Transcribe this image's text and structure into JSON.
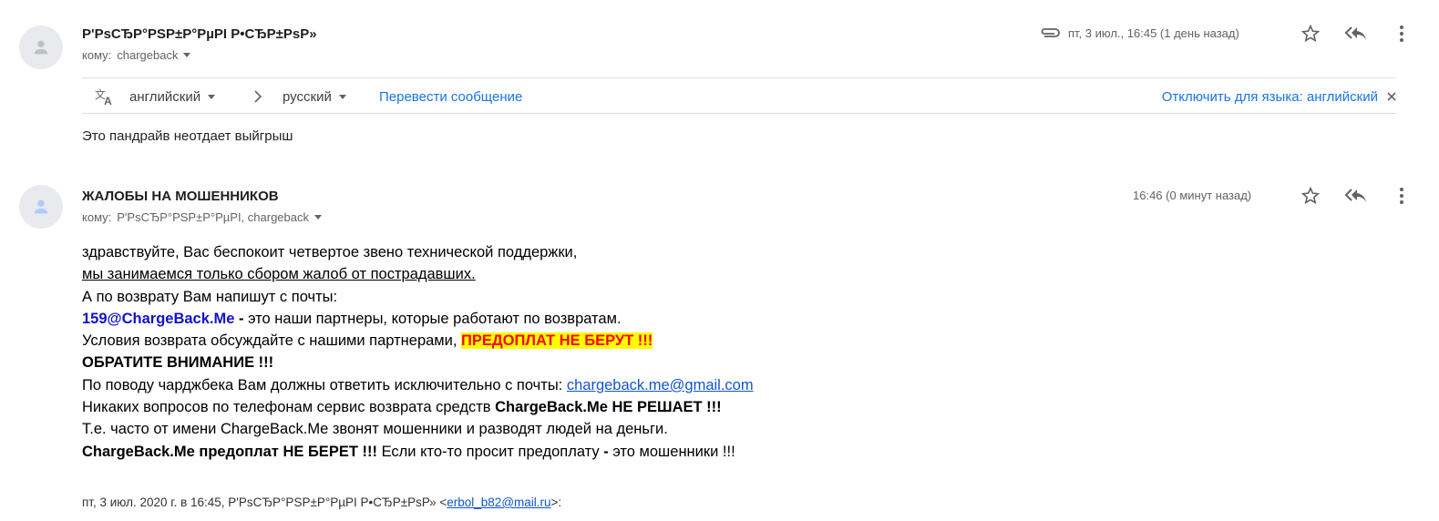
{
  "messages": [
    {
      "sender": "Р'РѕСЂР°РЅР±Р°РµРІ Р•СЂР±РѕР»",
      "to_prefix": "кому:",
      "to": "chargeback",
      "timestamp": "пт, 3 июл., 16:45 (1 день назад)",
      "has_attachment": true
    },
    {
      "sender": "ЖАЛОБЫ НА МОШЕННИКОВ",
      "to_prefix": "кому:",
      "to": "Р'РѕСЂР°РЅР±Р°РµРІ, chargeback",
      "timestamp": "16:46 (0 минут назад)"
    }
  ],
  "translate": {
    "from_lang": "английский",
    "to_lang": "русский",
    "translate_link": "Перевести сообщение",
    "disable_link": "Отключить для языка: английский"
  },
  "message1_body": "Это пандрайв неотдает выйгрыш",
  "message2_body": {
    "l1": "здравствуйте, Вас беспокоит четвертое звено технической поддержки,",
    "l2": "мы занимаемся только сбором жалоб от пострадавших.",
    "l3": "А по возврату Вам напишут с почты:",
    "l4_email": "159@ChargeBack.Me",
    "l4_dash": " -",
    "l4_rest": " это наши партнеры, которые работают по возвратам.",
    "l5_text": "Условия возврата обсуждайте с нашими партнерами, ",
    "l5_highlight": "ПРЕДОПЛАТ НЕ БЕРУТ !!!",
    "l6": "ОБРАТИТЕ ВНИМАНИЕ !!!",
    "l7_text": "По поводу чарджбека Вам должны ответить исключительно с почты: ",
    "l7_link": "chargeback.me@gmail.com",
    "l8_text": "Никаких вопросов по телефонам сервис возврата средств ",
    "l8_bold": "ChargeBack.Me НЕ РЕШАЕТ !!!",
    "l9": "Т.е. часто от имени ChargeBack.Me звонят мошенники и разводят людей на деньги.",
    "l10_bold": "ChargeBack.Me предоплат НЕ БЕРЕТ !!!",
    "l10_text": " Если кто-то просит предоплату ",
    "l10_dash": "-",
    "l10_end": " это мошенники !!!"
  },
  "quote": {
    "prefix": "пт, 3 июл. 2020 г. в 16:45, Р'РѕСЂР°РЅР±Р°РµРІ Р•СЂР±РѕР» <",
    "email": "erbol_b82@mail.ru",
    "suffix": ">:"
  },
  "icons": [
    "person-icon",
    "attachment-icon",
    "star-icon",
    "reply-all-icon",
    "more-vert-icon",
    "translate-icon",
    "close-icon"
  ]
}
